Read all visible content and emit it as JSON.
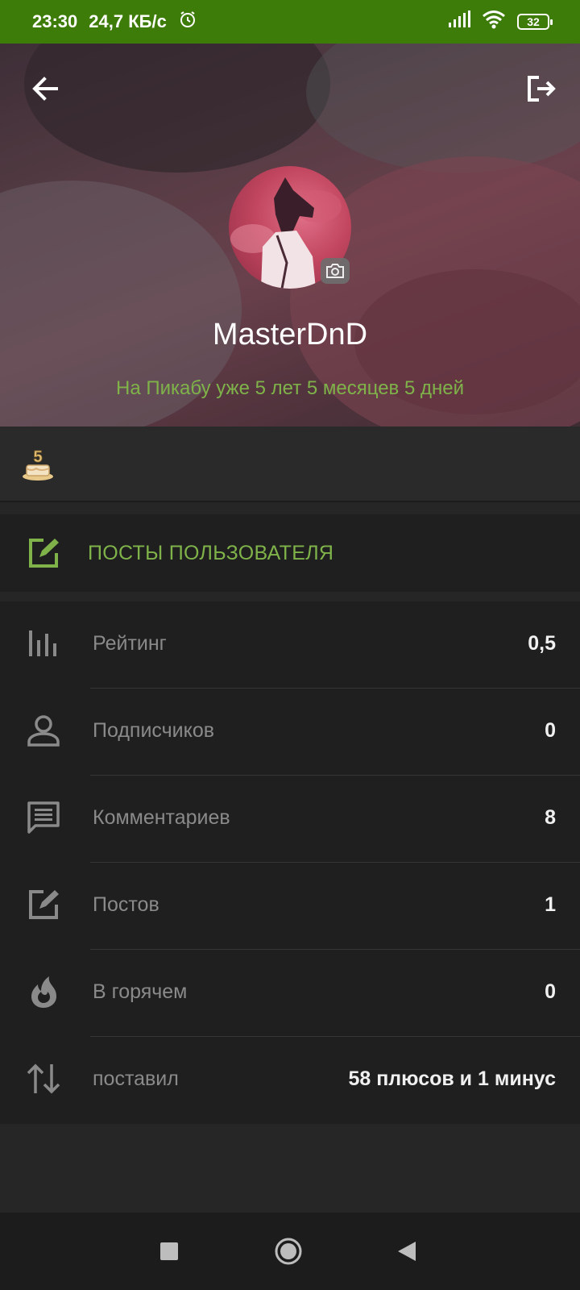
{
  "status_bar": {
    "time": "23:30",
    "speed": "24,7 КБ/с",
    "battery": "32"
  },
  "header": {
    "username": "MasterDnD",
    "since": "На Пикабу уже 5 лет 5 месяцев 5 дней",
    "accent_color": "#7fb34a"
  },
  "badges": [
    {
      "icon": "five-years-cake-icon",
      "label": "5"
    }
  ],
  "posts_button": {
    "label": "ПОСТЫ ПОЛЬЗОВАТЕЛЯ",
    "icon": "edit-icon"
  },
  "stats": [
    {
      "icon": "rating-bars-icon",
      "label": "Рейтинг",
      "value": "0,5"
    },
    {
      "icon": "person-icon",
      "label": "Подписчиков",
      "value": "0"
    },
    {
      "icon": "comment-icon",
      "label": "Комментариев",
      "value": "8"
    },
    {
      "icon": "edit-icon",
      "label": "Постов",
      "value": "1"
    },
    {
      "icon": "fire-icon",
      "label": "В горячем",
      "value": "0"
    },
    {
      "icon": "sort-arrows-icon",
      "label": "поставил",
      "value": "58 плюсов и 1 минус"
    }
  ]
}
